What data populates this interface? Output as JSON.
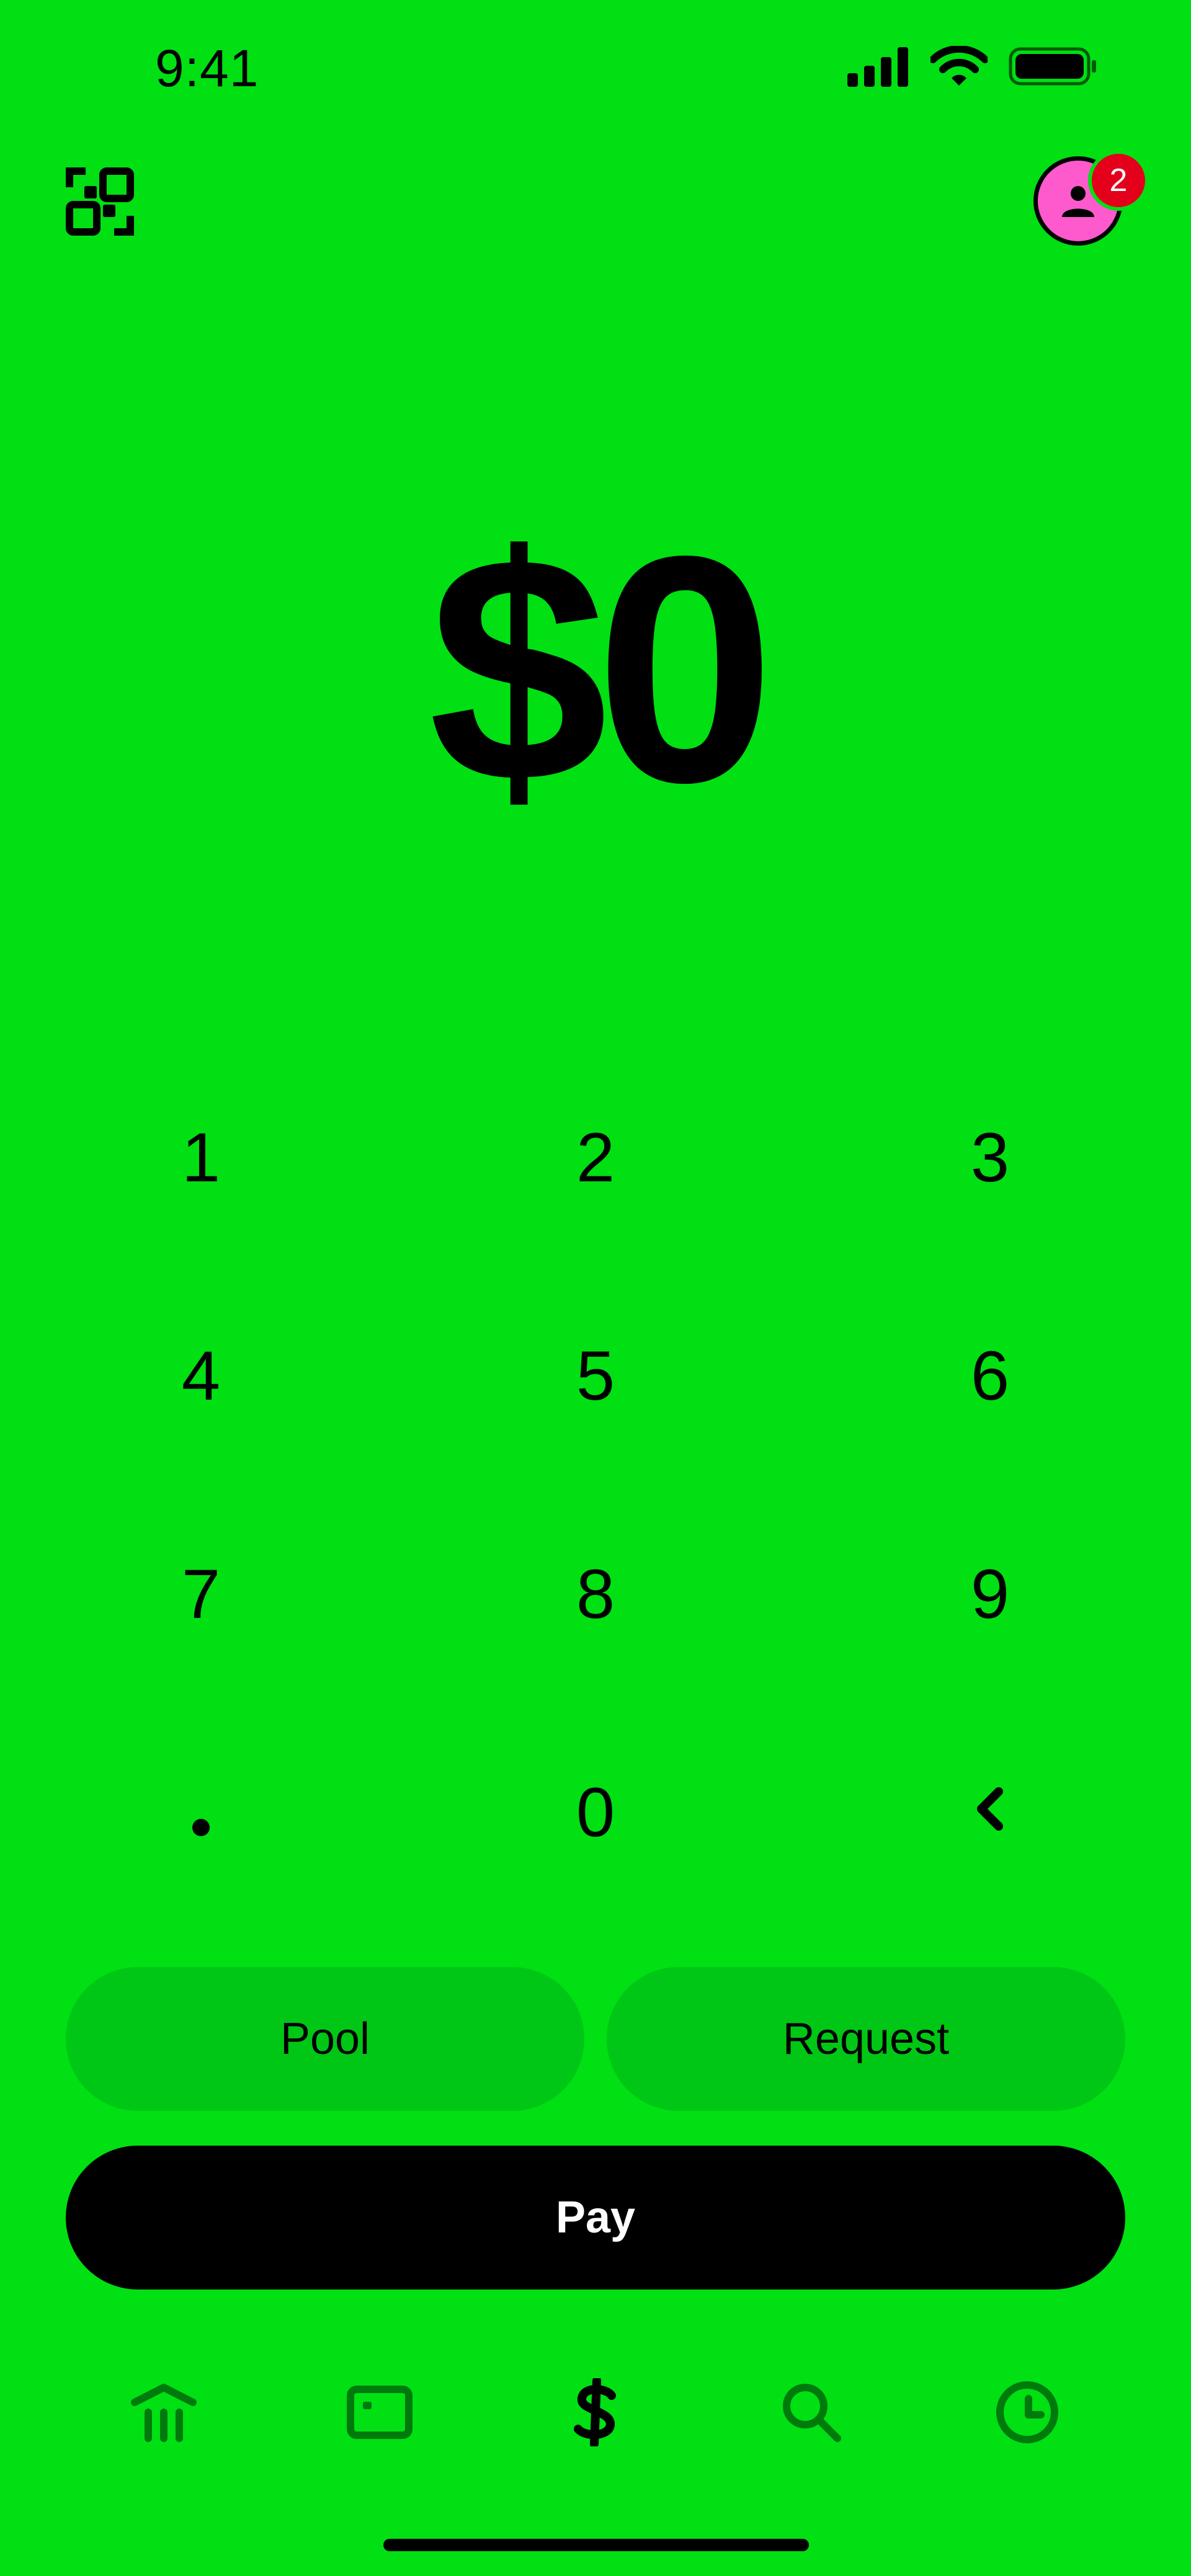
{
  "status_bar": {
    "time": "9:41"
  },
  "header": {
    "notification_count": "2"
  },
  "amount": {
    "display": "$0"
  },
  "keypad": {
    "keys": [
      "1",
      "2",
      "3",
      "4",
      "5",
      "6",
      "7",
      "8",
      "9",
      ".",
      "0",
      ""
    ]
  },
  "actions": {
    "pool_label": "Pool",
    "request_label": "Request",
    "pay_label": "Pay"
  },
  "tab_bar": {
    "tabs": [
      "bank-icon",
      "card-icon",
      "dollar-icon",
      "search-icon",
      "clock-icon"
    ],
    "active": "dollar-icon"
  },
  "colors": {
    "background": "#00E013",
    "button": "#00C715",
    "pay": "#000000",
    "avatar": "#FF5ACD",
    "badge": "#E4001A"
  }
}
